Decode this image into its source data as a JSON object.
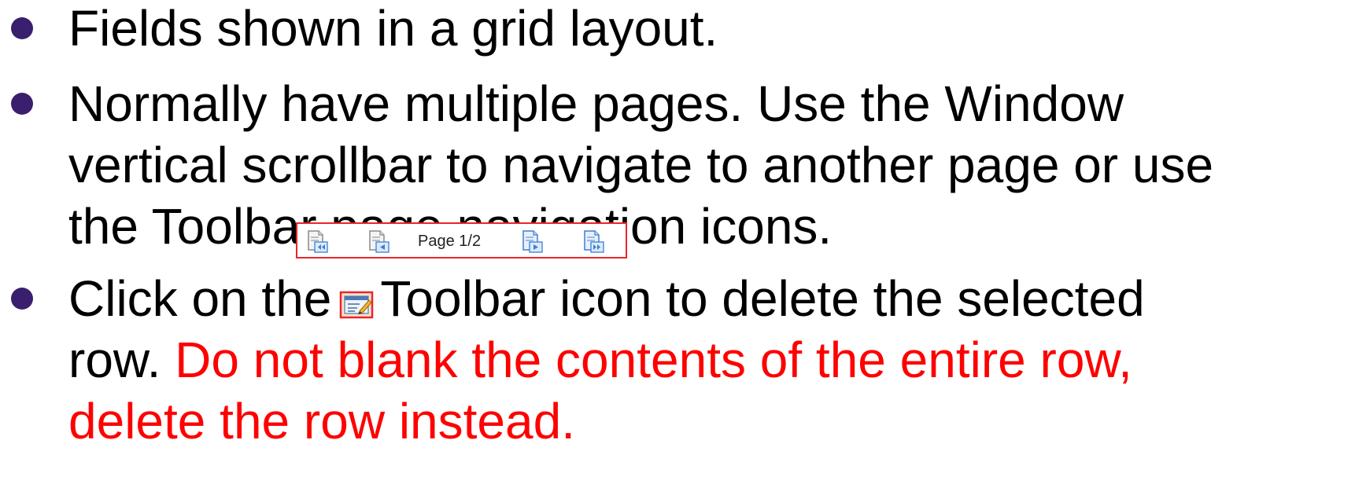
{
  "bullets": [
    {
      "lines": [
        "Fields shown in a grid layout."
      ]
    },
    {
      "lines": [
        "Normally have multiple pages. Use the Window",
        "vertical scrollbar to navigate to another page or use",
        "the Toolbar page navigation icons."
      ]
    },
    {
      "line1_before_icon": "Click on the",
      "line1_after_icon": "Toolbar icon to delete the selected",
      "line2_black": "row. ",
      "line2_red": "Do not blank the contents of the entire row,",
      "line3_red": "delete the row instead."
    }
  ],
  "toolbar": {
    "page_label": "Page 1/2",
    "icons": [
      "first-page-icon",
      "previous-page-icon",
      "next-page-icon",
      "last-page-icon"
    ],
    "delete_row_icon": "delete-row-icon"
  },
  "colors": {
    "text": "#000000",
    "emphasis": "#ff0000",
    "bullet": "#3a1f6e",
    "toolbar_border": "#e8262b",
    "icon_blue": "#3b7fd6"
  }
}
